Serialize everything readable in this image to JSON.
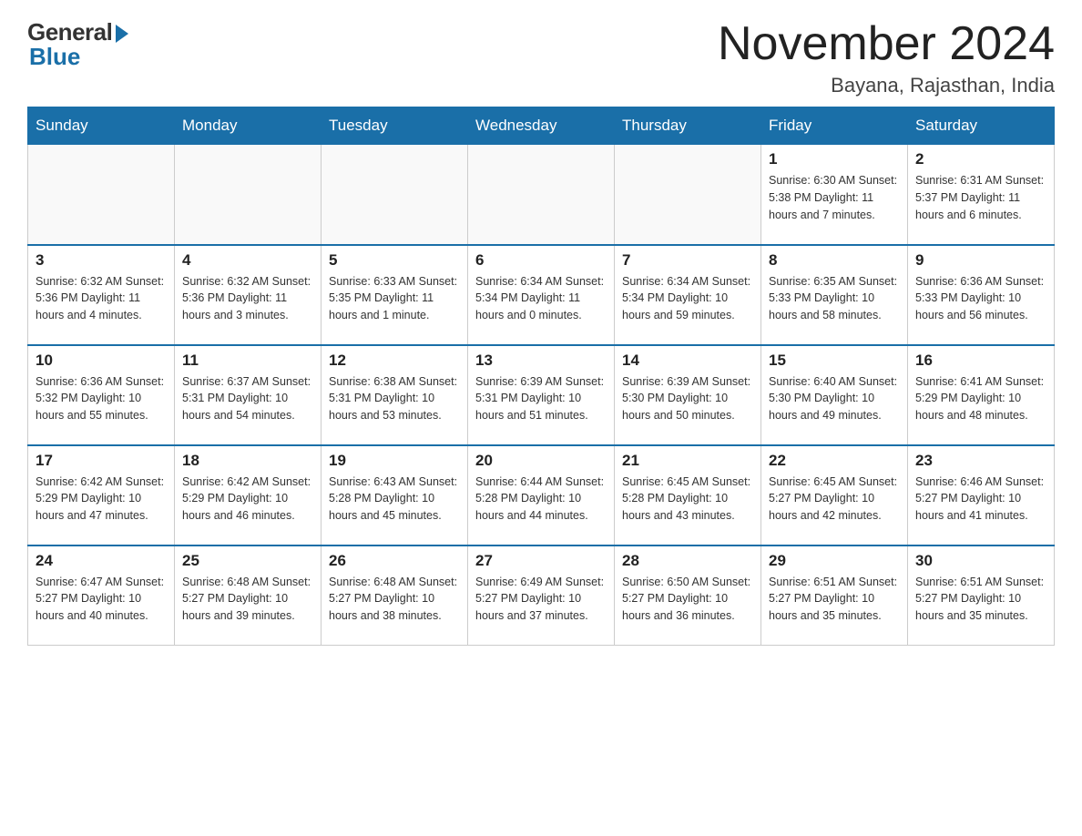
{
  "header": {
    "logo_general": "General",
    "logo_blue": "Blue",
    "month_year": "November 2024",
    "location": "Bayana, Rajasthan, India"
  },
  "days_of_week": [
    "Sunday",
    "Monday",
    "Tuesday",
    "Wednesday",
    "Thursday",
    "Friday",
    "Saturday"
  ],
  "weeks": [
    [
      {
        "day": "",
        "info": ""
      },
      {
        "day": "",
        "info": ""
      },
      {
        "day": "",
        "info": ""
      },
      {
        "day": "",
        "info": ""
      },
      {
        "day": "",
        "info": ""
      },
      {
        "day": "1",
        "info": "Sunrise: 6:30 AM\nSunset: 5:38 PM\nDaylight: 11 hours and 7 minutes."
      },
      {
        "day": "2",
        "info": "Sunrise: 6:31 AM\nSunset: 5:37 PM\nDaylight: 11 hours and 6 minutes."
      }
    ],
    [
      {
        "day": "3",
        "info": "Sunrise: 6:32 AM\nSunset: 5:36 PM\nDaylight: 11 hours and 4 minutes."
      },
      {
        "day": "4",
        "info": "Sunrise: 6:32 AM\nSunset: 5:36 PM\nDaylight: 11 hours and 3 minutes."
      },
      {
        "day": "5",
        "info": "Sunrise: 6:33 AM\nSunset: 5:35 PM\nDaylight: 11 hours and 1 minute."
      },
      {
        "day": "6",
        "info": "Sunrise: 6:34 AM\nSunset: 5:34 PM\nDaylight: 11 hours and 0 minutes."
      },
      {
        "day": "7",
        "info": "Sunrise: 6:34 AM\nSunset: 5:34 PM\nDaylight: 10 hours and 59 minutes."
      },
      {
        "day": "8",
        "info": "Sunrise: 6:35 AM\nSunset: 5:33 PM\nDaylight: 10 hours and 58 minutes."
      },
      {
        "day": "9",
        "info": "Sunrise: 6:36 AM\nSunset: 5:33 PM\nDaylight: 10 hours and 56 minutes."
      }
    ],
    [
      {
        "day": "10",
        "info": "Sunrise: 6:36 AM\nSunset: 5:32 PM\nDaylight: 10 hours and 55 minutes."
      },
      {
        "day": "11",
        "info": "Sunrise: 6:37 AM\nSunset: 5:31 PM\nDaylight: 10 hours and 54 minutes."
      },
      {
        "day": "12",
        "info": "Sunrise: 6:38 AM\nSunset: 5:31 PM\nDaylight: 10 hours and 53 minutes."
      },
      {
        "day": "13",
        "info": "Sunrise: 6:39 AM\nSunset: 5:31 PM\nDaylight: 10 hours and 51 minutes."
      },
      {
        "day": "14",
        "info": "Sunrise: 6:39 AM\nSunset: 5:30 PM\nDaylight: 10 hours and 50 minutes."
      },
      {
        "day": "15",
        "info": "Sunrise: 6:40 AM\nSunset: 5:30 PM\nDaylight: 10 hours and 49 minutes."
      },
      {
        "day": "16",
        "info": "Sunrise: 6:41 AM\nSunset: 5:29 PM\nDaylight: 10 hours and 48 minutes."
      }
    ],
    [
      {
        "day": "17",
        "info": "Sunrise: 6:42 AM\nSunset: 5:29 PM\nDaylight: 10 hours and 47 minutes."
      },
      {
        "day": "18",
        "info": "Sunrise: 6:42 AM\nSunset: 5:29 PM\nDaylight: 10 hours and 46 minutes."
      },
      {
        "day": "19",
        "info": "Sunrise: 6:43 AM\nSunset: 5:28 PM\nDaylight: 10 hours and 45 minutes."
      },
      {
        "day": "20",
        "info": "Sunrise: 6:44 AM\nSunset: 5:28 PM\nDaylight: 10 hours and 44 minutes."
      },
      {
        "day": "21",
        "info": "Sunrise: 6:45 AM\nSunset: 5:28 PM\nDaylight: 10 hours and 43 minutes."
      },
      {
        "day": "22",
        "info": "Sunrise: 6:45 AM\nSunset: 5:27 PM\nDaylight: 10 hours and 42 minutes."
      },
      {
        "day": "23",
        "info": "Sunrise: 6:46 AM\nSunset: 5:27 PM\nDaylight: 10 hours and 41 minutes."
      }
    ],
    [
      {
        "day": "24",
        "info": "Sunrise: 6:47 AM\nSunset: 5:27 PM\nDaylight: 10 hours and 40 minutes."
      },
      {
        "day": "25",
        "info": "Sunrise: 6:48 AM\nSunset: 5:27 PM\nDaylight: 10 hours and 39 minutes."
      },
      {
        "day": "26",
        "info": "Sunrise: 6:48 AM\nSunset: 5:27 PM\nDaylight: 10 hours and 38 minutes."
      },
      {
        "day": "27",
        "info": "Sunrise: 6:49 AM\nSunset: 5:27 PM\nDaylight: 10 hours and 37 minutes."
      },
      {
        "day": "28",
        "info": "Sunrise: 6:50 AM\nSunset: 5:27 PM\nDaylight: 10 hours and 36 minutes."
      },
      {
        "day": "29",
        "info": "Sunrise: 6:51 AM\nSunset: 5:27 PM\nDaylight: 10 hours and 35 minutes."
      },
      {
        "day": "30",
        "info": "Sunrise: 6:51 AM\nSunset: 5:27 PM\nDaylight: 10 hours and 35 minutes."
      }
    ]
  ]
}
